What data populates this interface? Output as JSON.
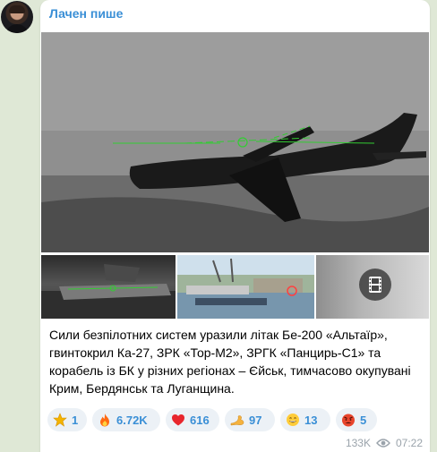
{
  "channel": {
    "name": "Лачен пише",
    "accent_color": "#3a8fd6"
  },
  "message": {
    "caption_lines": [
      "Сили безпілотних систем уразили літак Бе-200 «Альтаїр»,",
      "гвинтокрил Ка-27, ЗРК «Тор-М2», ЗРГК «Панцирь-С1» та",
      "корабель із БК у різних регіонах – Єйськ, тимчасово окупувані",
      "Крим, Бердянськ та Луганщина."
    ],
    "views": "133K",
    "time": "07:22",
    "media": {
      "main_icon": "aircraft-thermal-image",
      "thumbnails": [
        "thermal-ground-image",
        "harbor-ship-image",
        "video-thumbnail"
      ],
      "video_icon": "film-icon"
    },
    "reactions": [
      {
        "emoji": "star-icon",
        "count": "1"
      },
      {
        "emoji": "fire-icon",
        "count": "6.72K"
      },
      {
        "emoji": "heart-icon",
        "count": "616"
      },
      {
        "emoji": "flexed-arm-icon",
        "count": "97"
      },
      {
        "emoji": "grin-icon",
        "count": "13"
      },
      {
        "emoji": "angry-face-icon",
        "count": "5"
      }
    ]
  }
}
